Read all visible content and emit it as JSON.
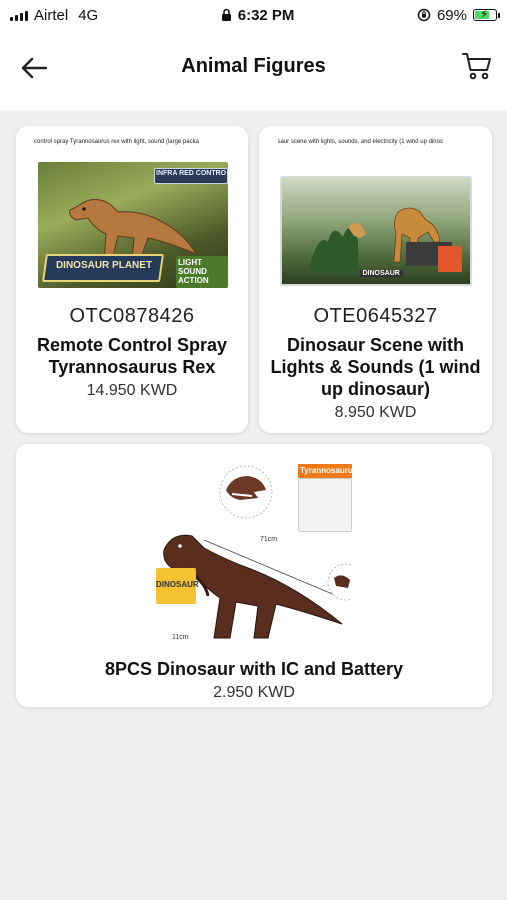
{
  "status_bar": {
    "carrier": "Airtel",
    "network": "4G",
    "time": "6:32 PM",
    "battery": "69%"
  },
  "header": {
    "title": "Animal Figures"
  },
  "products": [
    {
      "sku": "OTC0878426",
      "name": "Remote Control Spray Tyrannosaurus Rex",
      "price": "14.950 KWD",
      "image_caption": "control spray Tyrannosaurus rex with light, sound (large packa",
      "box_text_1": "INFRA RED CONTROL",
      "box_text_2": "DINOSAUR PLANET",
      "box_text_3": "LIGHT SOUND ACTION"
    },
    {
      "sku": "OTE0645327",
      "name": "Dinosaur Scene with Lights & Sounds (1 wind up  dinosaur)",
      "price": "8.950 KWD",
      "image_caption": "saur scene with lights, sounds, and electricity (1 wind up  dinos",
      "box_text_1": "DINOSAUR"
    },
    {
      "name": "8PCS Dinosaur with IC and Battery",
      "price": "2.950 KWD",
      "image_tag": "Tyrannosaurus",
      "image_box_label": "DINOSAUR",
      "image_measure_1": "71cm",
      "image_measure_2": "11cm"
    }
  ],
  "colors": {
    "background": "#efefef",
    "card": "#ffffff",
    "text": "#111111",
    "battery_fill": "#4cd964"
  }
}
